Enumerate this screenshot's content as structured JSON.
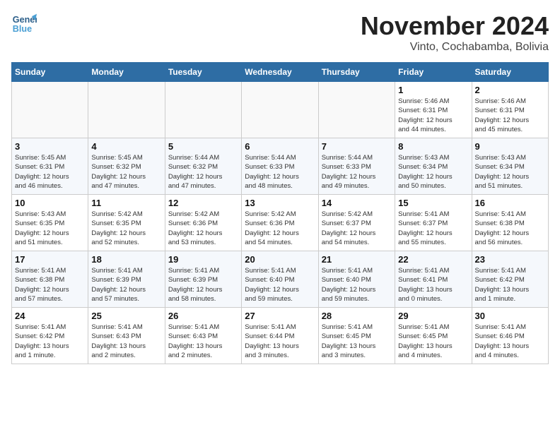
{
  "header": {
    "logo_line1": "General",
    "logo_line2": "Blue",
    "month": "November 2024",
    "location": "Vinto, Cochabamba, Bolivia"
  },
  "weekdays": [
    "Sunday",
    "Monday",
    "Tuesday",
    "Wednesday",
    "Thursday",
    "Friday",
    "Saturday"
  ],
  "weeks": [
    [
      {
        "day": "",
        "info": ""
      },
      {
        "day": "",
        "info": ""
      },
      {
        "day": "",
        "info": ""
      },
      {
        "day": "",
        "info": ""
      },
      {
        "day": "",
        "info": ""
      },
      {
        "day": "1",
        "info": "Sunrise: 5:46 AM\nSunset: 6:31 PM\nDaylight: 12 hours\nand 44 minutes."
      },
      {
        "day": "2",
        "info": "Sunrise: 5:46 AM\nSunset: 6:31 PM\nDaylight: 12 hours\nand 45 minutes."
      }
    ],
    [
      {
        "day": "3",
        "info": "Sunrise: 5:45 AM\nSunset: 6:31 PM\nDaylight: 12 hours\nand 46 minutes."
      },
      {
        "day": "4",
        "info": "Sunrise: 5:45 AM\nSunset: 6:32 PM\nDaylight: 12 hours\nand 47 minutes."
      },
      {
        "day": "5",
        "info": "Sunrise: 5:44 AM\nSunset: 6:32 PM\nDaylight: 12 hours\nand 47 minutes."
      },
      {
        "day": "6",
        "info": "Sunrise: 5:44 AM\nSunset: 6:33 PM\nDaylight: 12 hours\nand 48 minutes."
      },
      {
        "day": "7",
        "info": "Sunrise: 5:44 AM\nSunset: 6:33 PM\nDaylight: 12 hours\nand 49 minutes."
      },
      {
        "day": "8",
        "info": "Sunrise: 5:43 AM\nSunset: 6:34 PM\nDaylight: 12 hours\nand 50 minutes."
      },
      {
        "day": "9",
        "info": "Sunrise: 5:43 AM\nSunset: 6:34 PM\nDaylight: 12 hours\nand 51 minutes."
      }
    ],
    [
      {
        "day": "10",
        "info": "Sunrise: 5:43 AM\nSunset: 6:35 PM\nDaylight: 12 hours\nand 51 minutes."
      },
      {
        "day": "11",
        "info": "Sunrise: 5:42 AM\nSunset: 6:35 PM\nDaylight: 12 hours\nand 52 minutes."
      },
      {
        "day": "12",
        "info": "Sunrise: 5:42 AM\nSunset: 6:36 PM\nDaylight: 12 hours\nand 53 minutes."
      },
      {
        "day": "13",
        "info": "Sunrise: 5:42 AM\nSunset: 6:36 PM\nDaylight: 12 hours\nand 54 minutes."
      },
      {
        "day": "14",
        "info": "Sunrise: 5:42 AM\nSunset: 6:37 PM\nDaylight: 12 hours\nand 54 minutes."
      },
      {
        "day": "15",
        "info": "Sunrise: 5:41 AM\nSunset: 6:37 PM\nDaylight: 12 hours\nand 55 minutes."
      },
      {
        "day": "16",
        "info": "Sunrise: 5:41 AM\nSunset: 6:38 PM\nDaylight: 12 hours\nand 56 minutes."
      }
    ],
    [
      {
        "day": "17",
        "info": "Sunrise: 5:41 AM\nSunset: 6:38 PM\nDaylight: 12 hours\nand 57 minutes."
      },
      {
        "day": "18",
        "info": "Sunrise: 5:41 AM\nSunset: 6:39 PM\nDaylight: 12 hours\nand 57 minutes."
      },
      {
        "day": "19",
        "info": "Sunrise: 5:41 AM\nSunset: 6:39 PM\nDaylight: 12 hours\nand 58 minutes."
      },
      {
        "day": "20",
        "info": "Sunrise: 5:41 AM\nSunset: 6:40 PM\nDaylight: 12 hours\nand 59 minutes."
      },
      {
        "day": "21",
        "info": "Sunrise: 5:41 AM\nSunset: 6:40 PM\nDaylight: 12 hours\nand 59 minutes."
      },
      {
        "day": "22",
        "info": "Sunrise: 5:41 AM\nSunset: 6:41 PM\nDaylight: 13 hours\nand 0 minutes."
      },
      {
        "day": "23",
        "info": "Sunrise: 5:41 AM\nSunset: 6:42 PM\nDaylight: 13 hours\nand 1 minute."
      }
    ],
    [
      {
        "day": "24",
        "info": "Sunrise: 5:41 AM\nSunset: 6:42 PM\nDaylight: 13 hours\nand 1 minute."
      },
      {
        "day": "25",
        "info": "Sunrise: 5:41 AM\nSunset: 6:43 PM\nDaylight: 13 hours\nand 2 minutes."
      },
      {
        "day": "26",
        "info": "Sunrise: 5:41 AM\nSunset: 6:43 PM\nDaylight: 13 hours\nand 2 minutes."
      },
      {
        "day": "27",
        "info": "Sunrise: 5:41 AM\nSunset: 6:44 PM\nDaylight: 13 hours\nand 3 minutes."
      },
      {
        "day": "28",
        "info": "Sunrise: 5:41 AM\nSunset: 6:45 PM\nDaylight: 13 hours\nand 3 minutes."
      },
      {
        "day": "29",
        "info": "Sunrise: 5:41 AM\nSunset: 6:45 PM\nDaylight: 13 hours\nand 4 minutes."
      },
      {
        "day": "30",
        "info": "Sunrise: 5:41 AM\nSunset: 6:46 PM\nDaylight: 13 hours\nand 4 minutes."
      }
    ]
  ]
}
